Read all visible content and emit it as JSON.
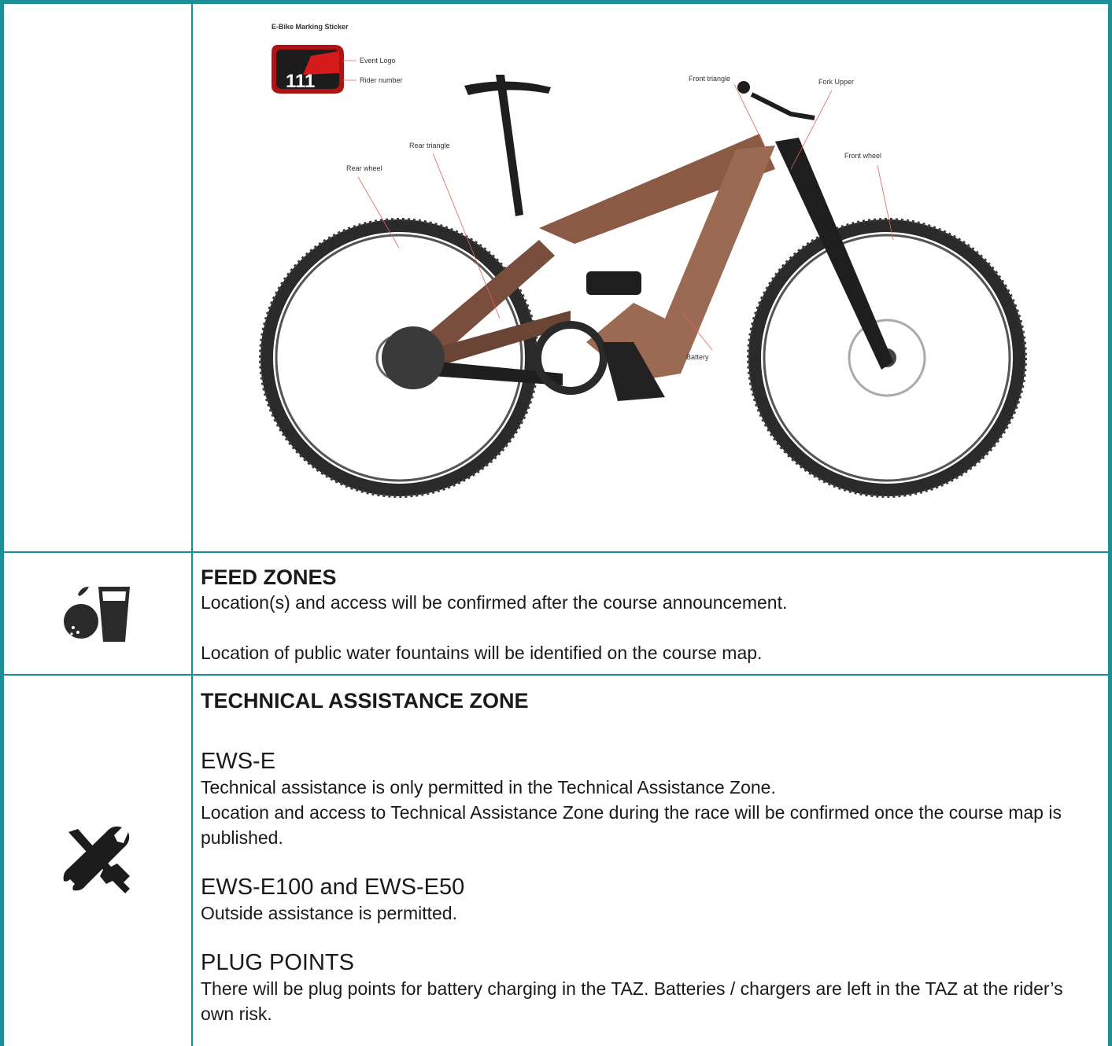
{
  "diagram": {
    "sticker_title": "E-Bike Marking Sticker",
    "sticker_number": "111",
    "labels": {
      "event_logo": "Event Logo",
      "rider_number": "Rider number",
      "front_triangle": "Front triangle",
      "fork_upper": "Fork Upper",
      "rear_triangle": "Rear triangle",
      "rear_wheel": "Rear wheel",
      "front_wheel": "Front wheel",
      "battery": "Battery"
    }
  },
  "feed_zones": {
    "icon": "fruit-and-drink-icon",
    "heading": "FEED ZONES",
    "line1": "Location(s) and access will be confirmed after the course announcement.",
    "line2": "Location of public water fountains will be identified on the course map."
  },
  "taz": {
    "icon": "tools-icon",
    "heading": "TECHNICAL ASSISTANCE ZONE",
    "ewse_title": "EWS-E",
    "ewse_line1": "Technical assistance is only permitted in the Technical Assistance Zone.",
    "ewse_line2": "Location and access to Technical Assistance Zone during the race will be confirmed once the course map is published.",
    "e100_title": "EWS-E100 and EWS-E50",
    "e100_line": "Outside assistance is permitted.",
    "plug_title": "PLUG POINTS",
    "plug_line": "There will be plug points for battery charging in the TAZ. Batteries / chargers are left in the TAZ at the rider’s own risk."
  },
  "colors": {
    "border": "#1a8f96",
    "frame": "#8a5a45"
  }
}
